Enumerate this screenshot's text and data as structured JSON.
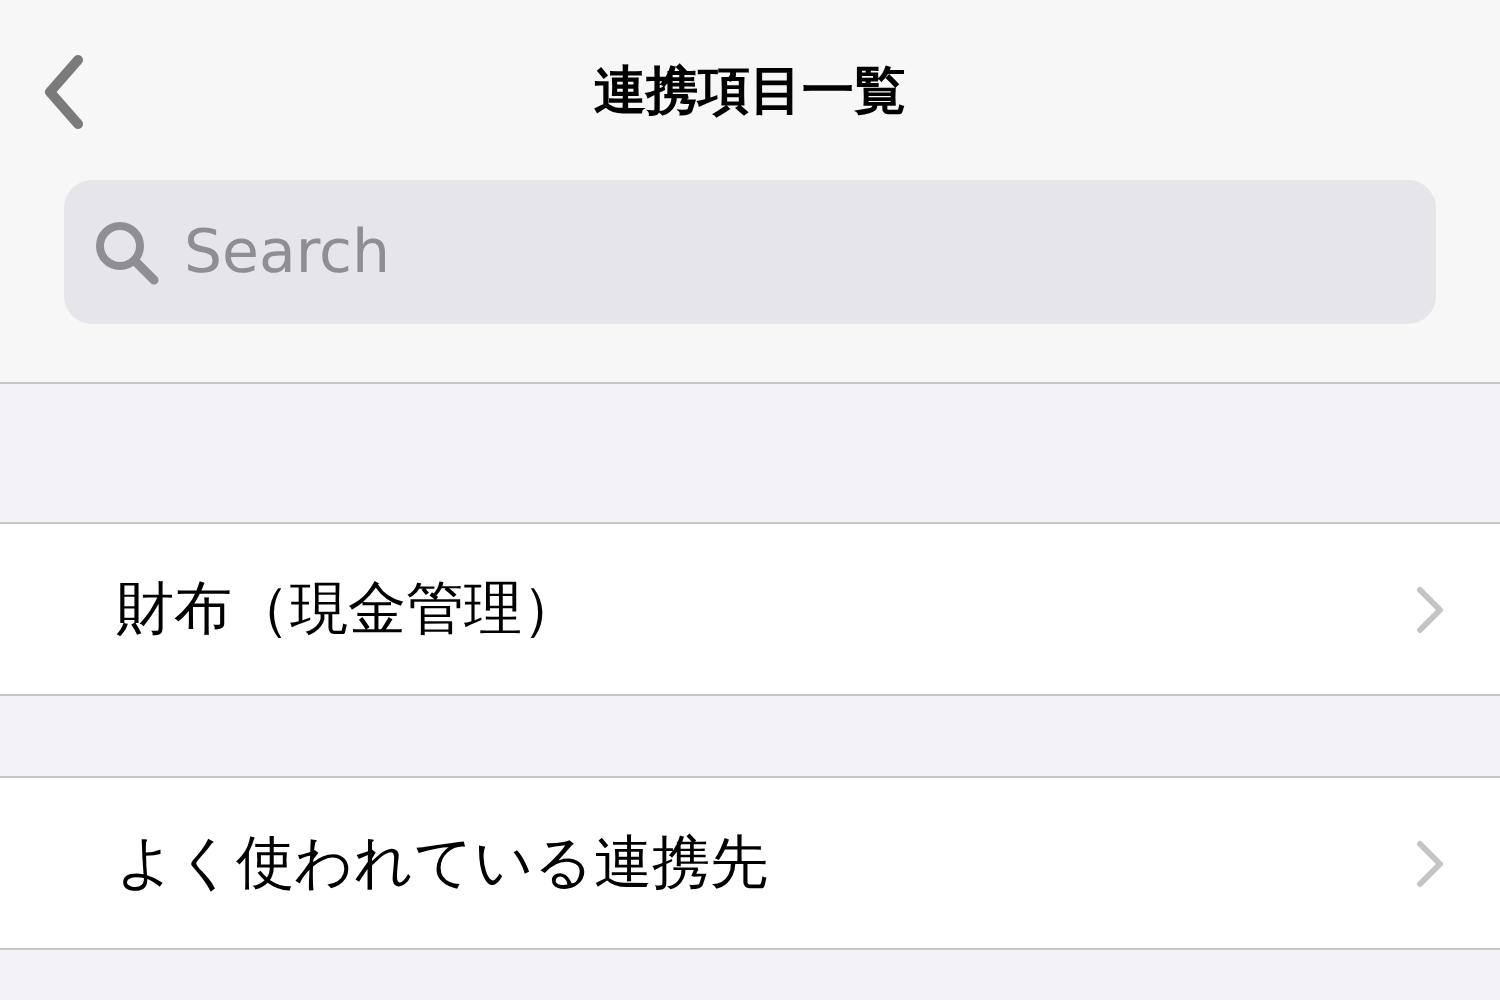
{
  "nav_bar": {
    "title": "連携項目一覧"
  },
  "search": {
    "placeholder": "Search"
  },
  "sections": [
    {
      "items": [
        {
          "label": "財布（現金管理）"
        }
      ]
    },
    {
      "items": [
        {
          "label": "よく使われている連携先"
        }
      ]
    }
  ]
}
